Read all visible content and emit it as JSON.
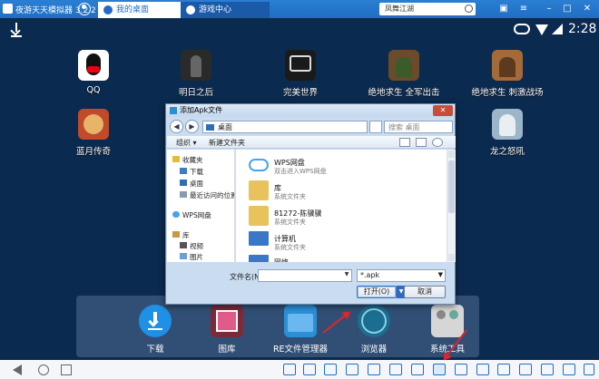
{
  "window": {
    "title": "夜游天天模拟器 3.2.2"
  },
  "tabs": [
    {
      "label": "我的桌面",
      "active": true
    },
    {
      "label": "游戏中心",
      "active": false
    }
  ],
  "top_search": {
    "value": "凤舞江湖"
  },
  "status_bar": {
    "time": "2:28"
  },
  "desktop_apps": [
    {
      "label": "QQ",
      "color": "#ffffff"
    },
    {
      "label": "明日之后",
      "color": "#2a2a2a"
    },
    {
      "label": "完美世界",
      "color": "#1a1a1a"
    },
    {
      "label": "绝地求生 全军出击",
      "color": "#6b4b2a"
    },
    {
      "label": "绝地求生 刺激战场",
      "color": "#a56a3a"
    },
    {
      "label": "蓝月传奇",
      "color": "#c04a2a"
    },
    {
      "label": "龙之怒吼",
      "color": "#9bb6c9"
    }
  ],
  "dock_apps": [
    {
      "label": "下载",
      "color": "#1e90e5"
    },
    {
      "label": "图库",
      "color": "#7b2a3a"
    },
    {
      "label": "RE文件管理器",
      "color": "#2b8fd6"
    },
    {
      "label": "浏览器",
      "color": "#1b6e8f"
    },
    {
      "label": "系统工具",
      "color": "#d6d6d6"
    }
  ],
  "dialog": {
    "title": "添加Apk文件",
    "address": "桌面",
    "search_placeholder": "搜索 桌面",
    "organize_label": "组织 ▾",
    "new_folder_label": "新建文件夹",
    "nav_items": [
      {
        "label": "收藏夹"
      },
      {
        "label": "下载"
      },
      {
        "label": "桌面"
      },
      {
        "label": "最近访问的位置"
      },
      {
        "label": "WPS网盘"
      },
      {
        "label": "库"
      },
      {
        "label": "视频"
      },
      {
        "label": "图片"
      }
    ],
    "files": [
      {
        "name": "WPS网盘",
        "sub": "双击进入WPS网盘"
      },
      {
        "name": "库",
        "sub": "系统文件夹"
      },
      {
        "name": "81272-陈骥骥",
        "sub": "系统文件夹"
      },
      {
        "name": "计算机",
        "sub": "系统文件夹"
      },
      {
        "name": "网络",
        "sub": ""
      }
    ],
    "filename_label": "文件名(N):",
    "filename_value": "",
    "filetype_value": "*.apk",
    "open_label": "打开(O)",
    "cancel_label": "取消",
    "close_label": "✕"
  }
}
